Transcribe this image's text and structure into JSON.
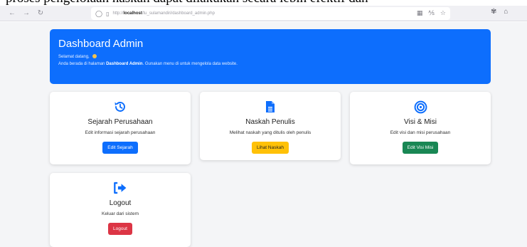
{
  "caption": "proses pengelolaan naskah dapat dilakukan secara lebih efektif dan",
  "browser": {
    "url_prefix": "http://",
    "url_host": "localhost",
    "url_path": "/tu_sulamandiri/dashboard_admin.php"
  },
  "header": {
    "title": "Dashboard Admin",
    "welcome": "Selamat datang,",
    "info_prefix": "Anda berada di halaman",
    "info_bold": "Dashboard Admin",
    "info_suffix": ". Gunakan menu di untuk mengelola data website."
  },
  "cards": [
    {
      "title": "Sejarah Perusahaan",
      "desc": "Edit informasi sejarah perusahaan",
      "button": "Edit Sejarah",
      "icon": "history-icon"
    },
    {
      "title": "Naskah Penulis",
      "desc": "Melihat naskah yang ditulis oleh penulis",
      "button": "Lihat Naskah",
      "icon": "document-icon"
    },
    {
      "title": "Visi & Misi",
      "desc": "Edit visi dan misi perusahaan",
      "button": "Edit Visi Misi",
      "icon": "target-icon"
    },
    {
      "title": "Logout",
      "desc": "Keluar dari sistem",
      "button": "Logout",
      "icon": "logout-icon"
    }
  ],
  "colors": {
    "primary": "#0d6efd",
    "warning": "#ffc107",
    "success": "#198754",
    "danger": "#dc3545"
  }
}
